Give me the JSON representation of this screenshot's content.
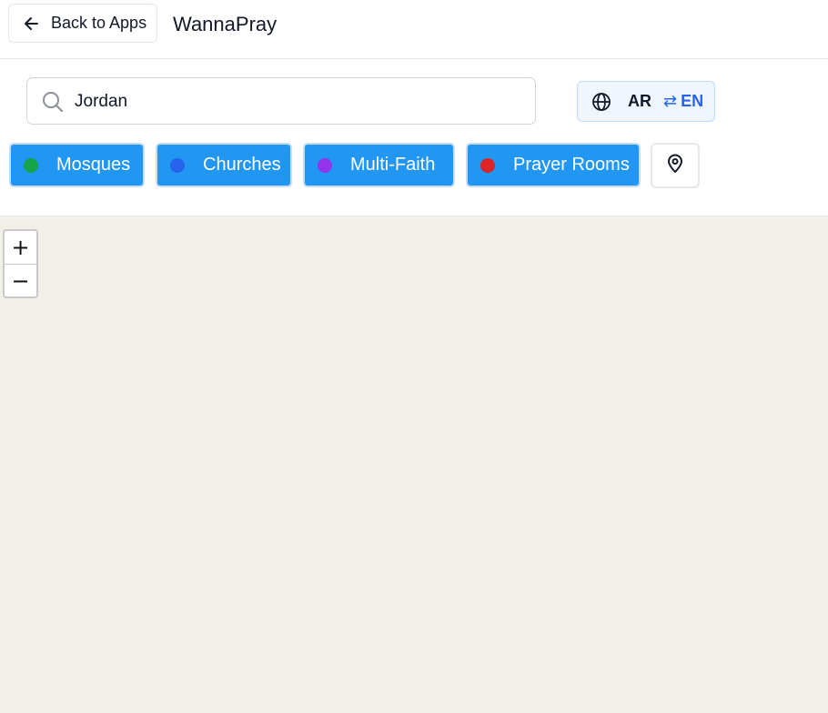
{
  "header": {
    "back_label": "Back to Apps",
    "back_icon": "arrow-left-icon",
    "title": "WannaPray"
  },
  "search": {
    "value": "Jordan",
    "icon": "search-icon"
  },
  "language": {
    "icon": "globe-icon",
    "current": "AR",
    "swap_symbol": "⇄",
    "alternate": "EN"
  },
  "filters": [
    {
      "label": "Mosques",
      "dot_color": "#16a34a"
    },
    {
      "label": "Churches",
      "dot_color": "#2563eb"
    },
    {
      "label": "Multi-Faith",
      "dot_color": "#9333ea"
    },
    {
      "label": "Prayer Rooms",
      "dot_color": "#dc2626"
    }
  ],
  "location": {
    "icon": "map-pin-icon"
  },
  "map": {
    "zoom_in_label": "+",
    "zoom_out_label": "−"
  },
  "colors": {
    "filter_button_bg": "#2196f3",
    "map_background": "#f2eee8",
    "accent": "#2563eb"
  }
}
